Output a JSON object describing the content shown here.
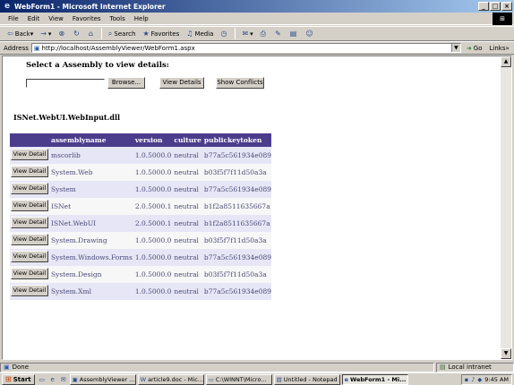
{
  "window": {
    "title": "WebForm1 - Microsoft Internet Explorer",
    "controls": [
      "_",
      "□",
      "×"
    ]
  },
  "menu": [
    "File",
    "Edit",
    "View",
    "Favorites",
    "Tools",
    "Help"
  ],
  "toolbar": {
    "back": "Back",
    "forward": "→",
    "stop": "⊗",
    "refresh": "↻",
    "home": "⌂",
    "search": "Search",
    "favorites": "Favorites",
    "media": "Media",
    "history": "◷"
  },
  "address": {
    "label": "Address",
    "url": "http://localhost/AssemblyViewer/WebForm1.aspx",
    "go": "Go",
    "links": "Links"
  },
  "page": {
    "select_heading": "Select a Assembly to view details:",
    "file_input_value": "",
    "browse_label": "Browse...",
    "view_details_label": "View Details",
    "show_conflicts_label": "Show Conflicts",
    "assembly_title": "ISNet.WebUI.WebInput.dll",
    "grid": {
      "columns": [
        "",
        "assemblyname",
        "version",
        "culture",
        "publickeytoken"
      ],
      "row_button_label": "View Detail",
      "rows": [
        {
          "name": "mscorlib",
          "version": "1.0.5000.0",
          "culture": "neutral",
          "token": "b77a5c561934e089"
        },
        {
          "name": "System.Web",
          "version": "1.0.5000.0",
          "culture": "neutral",
          "token": "b03f5f7f11d50a3a"
        },
        {
          "name": "System",
          "version": "1.0.5000.0",
          "culture": "neutral",
          "token": "b77a5c561934e089"
        },
        {
          "name": "ISNet",
          "version": "2.0.5000.1",
          "culture": "neutral",
          "token": "b1f2a8511635667a"
        },
        {
          "name": "ISNet.WebUI",
          "version": "2.0.5000.1",
          "culture": "neutral",
          "token": "b1f2a8511635667a"
        },
        {
          "name": "System.Drawing",
          "version": "1.0.5000.0",
          "culture": "neutral",
          "token": "b03f5f7f11d50a3a"
        },
        {
          "name": "System.Windows.Forms",
          "version": "1.0.5000.0",
          "culture": "neutral",
          "token": "b77a5c561934e089"
        },
        {
          "name": "System.Design",
          "version": "1.0.5000.0",
          "culture": "neutral",
          "token": "b03f5f7f11d50a3a"
        },
        {
          "name": "System.Xml",
          "version": "1.0.5000.0",
          "culture": "neutral",
          "token": "b77a5c561934e089"
        }
      ]
    }
  },
  "status": {
    "text": "Done",
    "zone": "Local intranet"
  },
  "taskbar": {
    "start": "Start",
    "tasks": [
      "AssemblyViewer ...",
      "article9.doc - Mic...",
      "C:\\WINNT\\Micro...",
      "Untitled - Notepad",
      "WebForm1 - Mi..."
    ],
    "clock": "9:45 AM"
  },
  "colors": {
    "grid_header": "#4b3c8c",
    "row_odd": "#e6e6f7",
    "row_even": "#f7f7f7",
    "title_bar": "#0a246a"
  }
}
